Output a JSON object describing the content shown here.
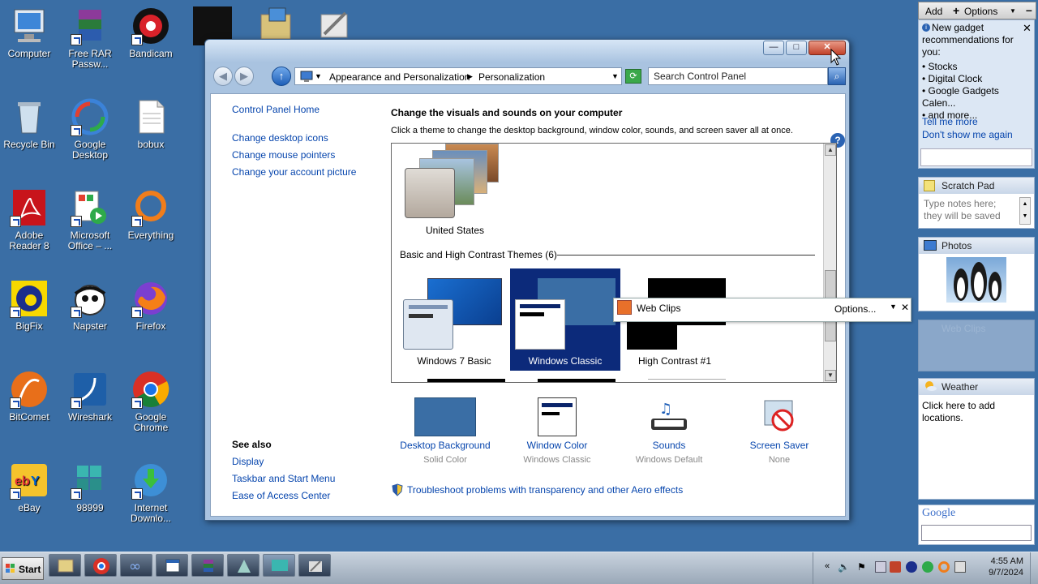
{
  "desktop_icons": [
    {
      "label": "Computer"
    },
    {
      "label": "Free RAR Passw..."
    },
    {
      "label": "Bandicam"
    },
    {
      "label": "Recycle Bin"
    },
    {
      "label": "Google Desktop"
    },
    {
      "label": "bobux"
    },
    {
      "label": "Adobe Reader 8"
    },
    {
      "label": "Microsoft Office – ..."
    },
    {
      "label": "Everything"
    },
    {
      "label": "BigFix"
    },
    {
      "label": "Napster"
    },
    {
      "label": "Firefox"
    },
    {
      "label": "BitComet"
    },
    {
      "label": "Wireshark"
    },
    {
      "label": "Google Chrome"
    },
    {
      "label": "eBay"
    },
    {
      "label": "98999"
    },
    {
      "label": "Internet Downlo..."
    }
  ],
  "window": {
    "breadcrumb": [
      "Appearance and Personalization",
      "Personalization"
    ],
    "search_placeholder": "Search Control Panel",
    "left_links": [
      "Control Panel Home",
      "Change desktop icons",
      "Change mouse pointers",
      "Change your account picture"
    ],
    "see_also_title": "See also",
    "see_also_links": [
      "Display",
      "Taskbar and Start Menu",
      "Ease of Access Center"
    ],
    "heading": "Change the visuals and sounds on your computer",
    "subheading": "Click a theme to change the desktop background, window color, sounds, and screen saver all at once.",
    "themes_top": {
      "label": "United States"
    },
    "basic_section_title": "Basic and High Contrast Themes (6)",
    "basic_themes": [
      {
        "label": "Windows 7 Basic"
      },
      {
        "label": "Windows Classic",
        "selected": true
      },
      {
        "label": "High Contrast #1"
      }
    ],
    "bottom_items": [
      {
        "label": "Desktop Background",
        "sub": "Solid Color"
      },
      {
        "label": "Window Color",
        "sub": "Windows Classic"
      },
      {
        "label": "Sounds",
        "sub": "Windows Default"
      },
      {
        "label": "Screen Saver",
        "sub": "None"
      }
    ],
    "troubleshoot": "Troubleshoot problems with transparency and other Aero effects",
    "help_glyph": "?"
  },
  "webclips_float": {
    "title": "Web Clips",
    "options": "Options...",
    "close": "✕"
  },
  "sidebar": {
    "add": "Add",
    "options": "Options",
    "gadget_notice": {
      "title": "New gadget recommendations for you:",
      "items": [
        "• Stocks",
        "• Digital Clock",
        "• Google Gadgets Calen...",
        "• and more..."
      ],
      "tell_more": "Tell me more",
      "dont_show": "Don't show me again"
    },
    "scratch": {
      "title": "Scratch Pad",
      "placeholder": "Type notes here; they will be saved"
    },
    "photos": {
      "title": "Photos"
    },
    "webclips": {
      "title": "Web Clips"
    },
    "weather": {
      "title": "Weather",
      "text": "Click here to add locations."
    },
    "google": {
      "title": "Google"
    }
  },
  "taskbar": {
    "start": "Start",
    "time": "4:55 AM",
    "date": "9/7/2024"
  },
  "colors": {
    "desktop": "#3a6ea5",
    "link": "#0645ad",
    "selected_theme": "#0c2a7a"
  }
}
